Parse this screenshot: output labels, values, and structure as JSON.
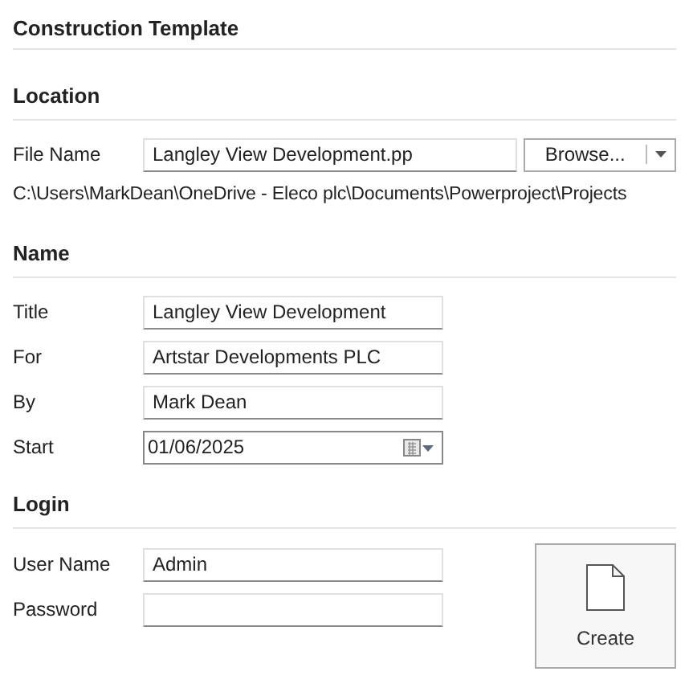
{
  "title": "Construction Template",
  "location": {
    "heading": "Location",
    "file_name": {
      "label": "File Name",
      "value": "Langley View Development.pp"
    },
    "browse_button": {
      "label": "Browse..."
    },
    "path": "C:\\Users\\MarkDean\\OneDrive - Eleco plc\\Documents\\Powerproject\\Projects"
  },
  "name": {
    "heading": "Name",
    "fields": [
      {
        "kind": "text",
        "label": "Title",
        "value": "Langley View Development"
      },
      {
        "kind": "text",
        "label": "For",
        "value": "Artstar Developments PLC"
      },
      {
        "kind": "text",
        "label": "By",
        "value": "Mark Dean"
      },
      {
        "kind": "date",
        "label": "Start",
        "value": "01/06/2025"
      }
    ]
  },
  "login": {
    "heading": "Login",
    "fields": [
      {
        "kind": "text",
        "label": "User Name",
        "value": "Admin"
      },
      {
        "kind": "password",
        "label": "Password"
      }
    ]
  },
  "create_button": {
    "label": "Create"
  }
}
